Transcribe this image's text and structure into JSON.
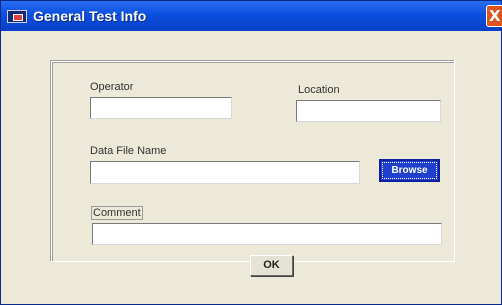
{
  "window": {
    "title": "General Test Info",
    "close_label": "X"
  },
  "form": {
    "operator": {
      "label": "Operator",
      "value": ""
    },
    "location": {
      "label": "Location",
      "value": ""
    },
    "data_file_name": {
      "label": "Data File Name",
      "value": ""
    },
    "browse_label": "Browse",
    "comment": {
      "label": "Comment",
      "value": ""
    }
  },
  "actions": {
    "ok_label": "OK"
  },
  "colors": {
    "titlebar": "#0b4fe0",
    "window_bg": "#ece9d8",
    "browse_bg": "#1e3fd0",
    "close_bg": "#e0521e"
  }
}
